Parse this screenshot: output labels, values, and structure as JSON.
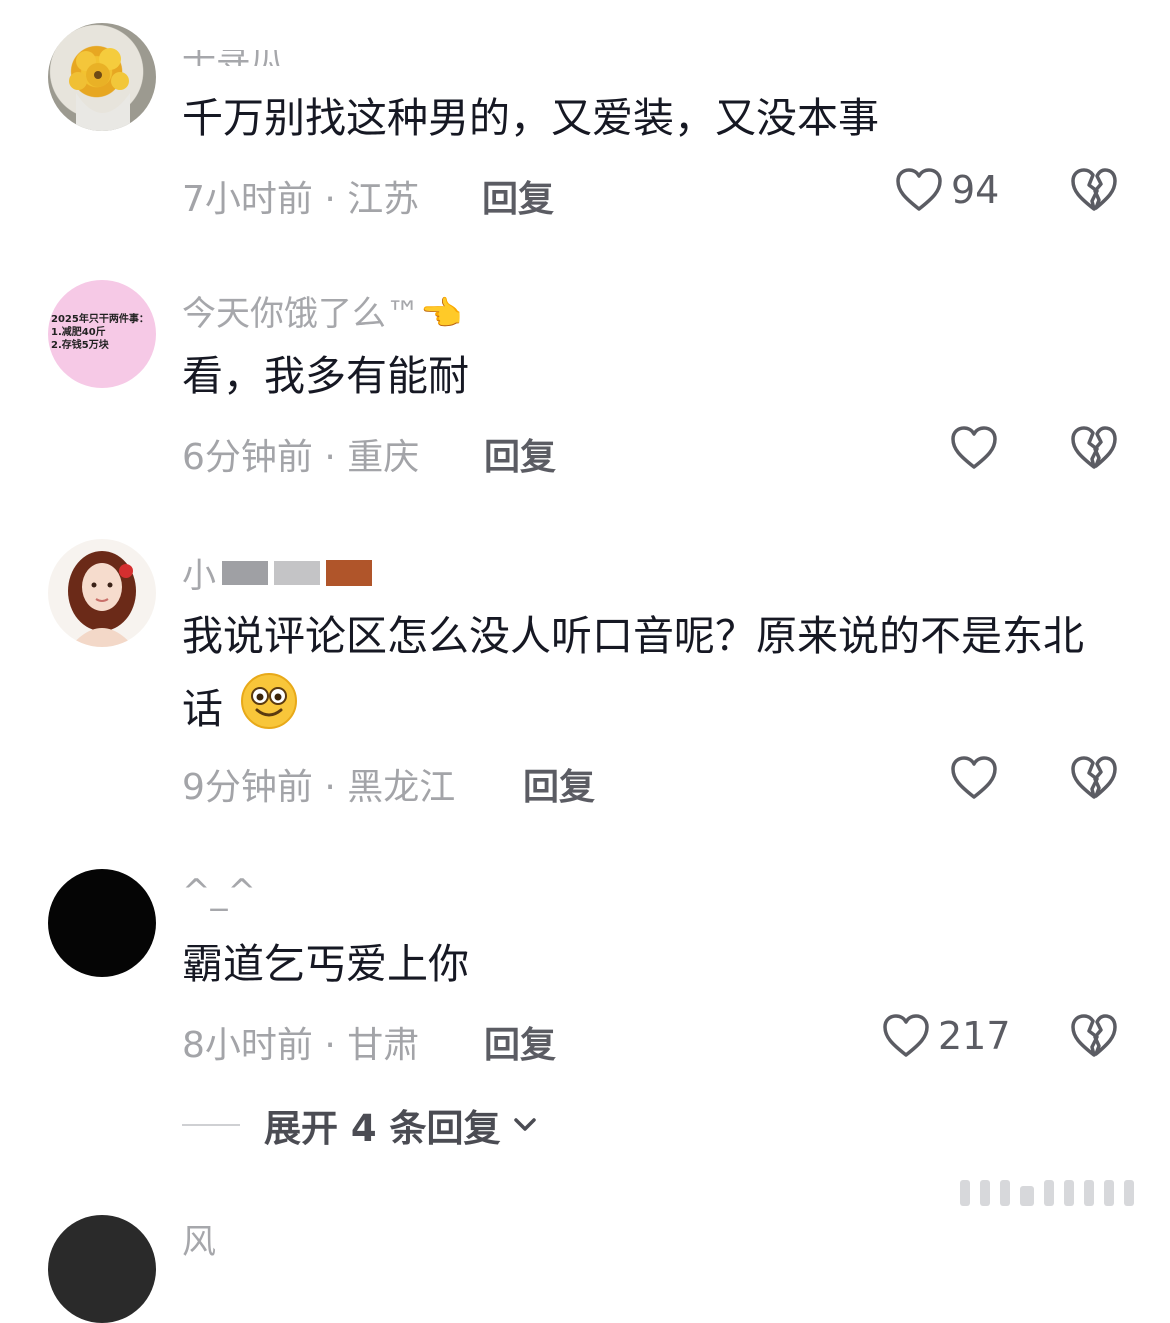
{
  "comments": [
    {
      "username": "千寻瓜",
      "text": "千万别找这种男的，又爱装，又没本事",
      "meta": "7小时前 · 江苏",
      "reply_label": "回复",
      "likes": "94",
      "avatar_kind": "flowers"
    },
    {
      "username": "今天你饿了么™👈",
      "text": "看，我多有能耐",
      "meta": "6分钟前 · 重庆",
      "reply_label": "回复",
      "likes": "",
      "avatar_kind": "pink-note",
      "avatar_lines": [
        "2025年只干两件事：",
        "1.减肥40斤",
        "2.存钱5万块"
      ]
    },
    {
      "username": "小",
      "text": "我说评论区怎么没人听口音呢？原来说的不是东北话",
      "meta": "9分钟前 · 黑龙江",
      "reply_label": "回复",
      "likes": "",
      "avatar_kind": "portrait"
    },
    {
      "username": "^_^",
      "text": "霸道乞丐爱上你",
      "meta": "8小时前 · 甘肃",
      "reply_label": "回复",
      "likes": "217",
      "avatar_kind": "black"
    }
  ],
  "expand_replies_label": "展开 4 条回复",
  "next_comment_username": "风 ",
  "colors": {
    "text_primary": "#161823",
    "text_secondary": "#a3a4a8",
    "icon": "#5b5c63"
  }
}
